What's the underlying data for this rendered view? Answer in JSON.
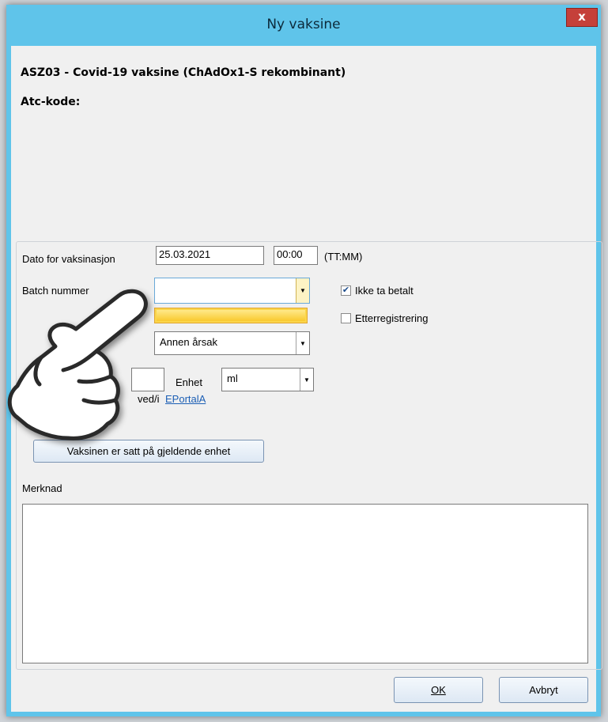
{
  "window": {
    "title": "Ny vaksine",
    "close_label": "x"
  },
  "header": {
    "vaccine": "ASZ03 - Covid-19 vaksine (ChAdOx1-S rekombinant)",
    "atc_label": "Atc-kode:"
  },
  "form": {
    "date_label": "Dato for vaksinasjon",
    "date_value": "25.03.2021",
    "time_value": "00:00",
    "time_hint": "(TT:MM)",
    "batch_label": "Batch nummer",
    "batch_value": "",
    "reason_value": "Annen årsak",
    "unit_label": "Enhet",
    "unit_value": "ml",
    "given_label": "ved/i",
    "portal_link": "EPortalA",
    "set_unit_button": "Vaksinen er satt på gjeldende enhet",
    "note_label": "Merknad",
    "note_value": ""
  },
  "checkboxes": {
    "ikke_ta_betalt": {
      "label": "Ikke ta betalt",
      "checked": true
    },
    "etterregistrering": {
      "label": "Etterregistrering",
      "checked": false
    }
  },
  "buttons": {
    "ok": "OK",
    "cancel": "Avbryt"
  },
  "colors": {
    "titlebar": "#5fc4ea",
    "close": "#c5403a",
    "highlight": "#fbd64a",
    "link": "#1c5fb5"
  }
}
